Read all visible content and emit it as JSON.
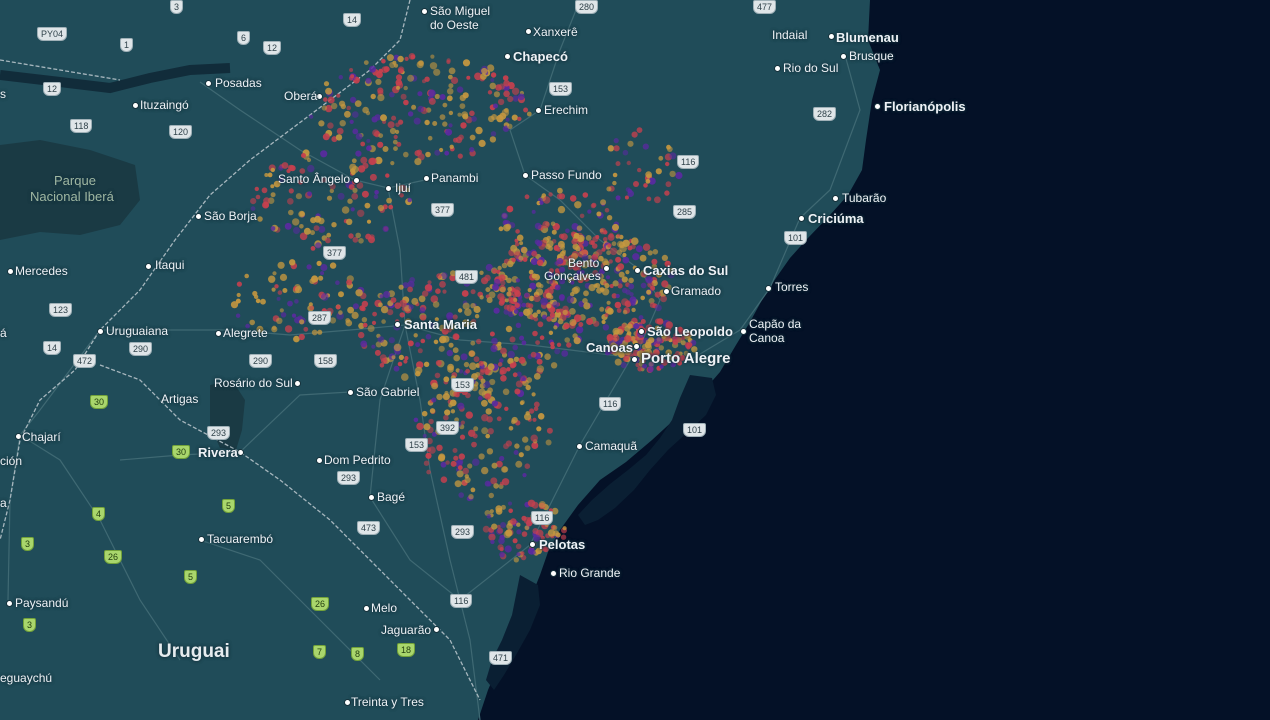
{
  "map": {
    "colors": {
      "ocean": "#041127",
      "land": "#204c59",
      "land_dark": "#193e49",
      "park": "#1a3a44",
      "border": "#a7b7be",
      "road": "#3f6973",
      "heat_low": "#c6983f",
      "heat_mid": "#c8404e",
      "heat_high": "#5a2aa0"
    },
    "labels": [
      {
        "id": "sao-miguel",
        "text": "São Miguel",
        "cls": ""
      },
      {
        "id": "do-oeste",
        "text": "do Oeste",
        "cls": ""
      },
      {
        "id": "xanxere",
        "text": "Xanxerê",
        "cls": ""
      },
      {
        "id": "chapeco",
        "text": "Chapecó",
        "cls": "major"
      },
      {
        "id": "indaial",
        "text": "Indaial",
        "cls": ""
      },
      {
        "id": "blumenau",
        "text": "Blumenau",
        "cls": "major"
      },
      {
        "id": "brusque",
        "text": "Brusque",
        "cls": ""
      },
      {
        "id": "rio-do-sul",
        "text": "Rio do Sul",
        "cls": ""
      },
      {
        "id": "florianopolis",
        "text": "Florianópolis",
        "cls": "major"
      },
      {
        "id": "tubarao",
        "text": "Tubarão",
        "cls": ""
      },
      {
        "id": "criciuma",
        "text": "Criciúma",
        "cls": "major"
      },
      {
        "id": "torres",
        "text": "Torres",
        "cls": ""
      },
      {
        "id": "capao-1",
        "text": "Capão da",
        "cls": ""
      },
      {
        "id": "capao-2",
        "text": "Canoa",
        "cls": ""
      },
      {
        "id": "posadas",
        "text": "Posadas",
        "cls": ""
      },
      {
        "id": "ituzaingo",
        "text": "Ituzaingó",
        "cls": ""
      },
      {
        "id": "obera",
        "text": "Oberá",
        "cls": ""
      },
      {
        "id": "erechim",
        "text": "Erechim",
        "cls": ""
      },
      {
        "id": "passo-fundo",
        "text": "Passo Fundo",
        "cls": ""
      },
      {
        "id": "santo-angelo",
        "text": "Santo Ângelo",
        "cls": ""
      },
      {
        "id": "ijui",
        "text": "Ijuí",
        "cls": ""
      },
      {
        "id": "panambi",
        "text": "Panambi",
        "cls": ""
      },
      {
        "id": "sao-borja",
        "text": "São Borja",
        "cls": ""
      },
      {
        "id": "bento-1",
        "text": "Bento",
        "cls": ""
      },
      {
        "id": "bento-2",
        "text": "Gonçalves",
        "cls": ""
      },
      {
        "id": "caxias",
        "text": "Caxias do Sul",
        "cls": "major"
      },
      {
        "id": "gramado",
        "text": "Gramado",
        "cls": ""
      },
      {
        "id": "mercedes",
        "text": "Mercedes",
        "cls": ""
      },
      {
        "id": "itaqui",
        "text": "Itaqui",
        "cls": ""
      },
      {
        "id": "santa-maria",
        "text": "Santa Maria",
        "cls": "major"
      },
      {
        "id": "sao-leopoldo",
        "text": "São Leopoldo",
        "cls": "major"
      },
      {
        "id": "canoas",
        "text": "Canoas",
        "cls": "major"
      },
      {
        "id": "porto-alegre",
        "text": "Porto Alegre",
        "cls": "major big"
      },
      {
        "id": "uruguaiana",
        "text": "Uruguaiana",
        "cls": ""
      },
      {
        "id": "alegrete",
        "text": "Alegrete",
        "cls": ""
      },
      {
        "id": "rosario",
        "text": "Rosário do Sul",
        "cls": ""
      },
      {
        "id": "sao-gabriel",
        "text": "São Gabriel",
        "cls": ""
      },
      {
        "id": "artigas",
        "text": "Artigas",
        "cls": ""
      },
      {
        "id": "chajari",
        "text": "Chajarí",
        "cls": ""
      },
      {
        "id": "rivera",
        "text": "Rivera",
        "cls": "major"
      },
      {
        "id": "dom-pedrito",
        "text": "Dom Pedrito",
        "cls": ""
      },
      {
        "id": "camaqua",
        "text": "Camaquã",
        "cls": ""
      },
      {
        "id": "bage",
        "text": "Bagé",
        "cls": ""
      },
      {
        "id": "tacuarembo",
        "text": "Tacuarembó",
        "cls": ""
      },
      {
        "id": "pelotas",
        "text": "Pelotas",
        "cls": "major"
      },
      {
        "id": "rio-grande",
        "text": "Rio Grande",
        "cls": ""
      },
      {
        "id": "paysandu",
        "text": "Paysandú",
        "cls": ""
      },
      {
        "id": "melo",
        "text": "Melo",
        "cls": ""
      },
      {
        "id": "jaguarao",
        "text": "Jaguarão",
        "cls": ""
      },
      {
        "id": "treinta",
        "text": "Treinta y Tres",
        "cls": ""
      },
      {
        "id": "uruguai",
        "text": "Uruguai",
        "cls": "country"
      },
      {
        "id": "eguaychu",
        "text": "eguaychú",
        "cls": ""
      },
      {
        "id": "frag-s",
        "text": "s",
        "cls": ""
      },
      {
        "id": "frag-a",
        "text": "á",
        "cls": ""
      },
      {
        "id": "frag-cion",
        "text": "ción",
        "cls": ""
      },
      {
        "id": "frag-dot",
        "text": "a",
        "cls": ""
      },
      {
        "id": "park-1",
        "text": "Parque",
        "cls": "park"
      },
      {
        "id": "park-2",
        "text": "Nacional Iberá",
        "cls": "park"
      }
    ],
    "shields": [
      {
        "id": "py04",
        "text": "PY04",
        "cls": ""
      },
      {
        "id": "r280a",
        "text": "280",
        "cls": ""
      },
      {
        "id": "r477",
        "text": "477",
        "cls": ""
      },
      {
        "id": "r14",
        "text": "14",
        "cls": ""
      },
      {
        "id": "r6",
        "text": "6",
        "cls": ""
      },
      {
        "id": "r1",
        "text": "1",
        "cls": ""
      },
      {
        "id": "r12",
        "text": "12",
        "cls": ""
      },
      {
        "id": "r3",
        "text": "3",
        "cls": ""
      },
      {
        "id": "r12b",
        "text": "12",
        "cls": ""
      },
      {
        "id": "r118",
        "text": "118",
        "cls": ""
      },
      {
        "id": "r120",
        "text": "120",
        "cls": ""
      },
      {
        "id": "r153a",
        "text": "153",
        "cls": ""
      },
      {
        "id": "r282",
        "text": "282",
        "cls": ""
      },
      {
        "id": "r116a",
        "text": "116",
        "cls": ""
      },
      {
        "id": "r285",
        "text": "285",
        "cls": ""
      },
      {
        "id": "r377a",
        "text": "377",
        "cls": ""
      },
      {
        "id": "r377b",
        "text": "377",
        "cls": ""
      },
      {
        "id": "r101a",
        "text": "101",
        "cls": ""
      },
      {
        "id": "r481",
        "text": "481",
        "cls": ""
      },
      {
        "id": "r123",
        "text": "123",
        "cls": ""
      },
      {
        "id": "r287",
        "text": "287",
        "cls": ""
      },
      {
        "id": "r14b",
        "text": "14",
        "cls": ""
      },
      {
        "id": "r290a",
        "text": "290",
        "cls": ""
      },
      {
        "id": "r290b",
        "text": "290",
        "cls": ""
      },
      {
        "id": "r158",
        "text": "158",
        "cls": ""
      },
      {
        "id": "r472",
        "text": "472",
        "cls": ""
      },
      {
        "id": "r153b",
        "text": "153",
        "cls": ""
      },
      {
        "id": "r116b",
        "text": "116",
        "cls": ""
      },
      {
        "id": "r392",
        "text": "392",
        "cls": ""
      },
      {
        "id": "r101b",
        "text": "101",
        "cls": ""
      },
      {
        "id": "r30a",
        "text": "30",
        "cls": "green"
      },
      {
        "id": "r293a",
        "text": "293",
        "cls": ""
      },
      {
        "id": "r153c",
        "text": "153",
        "cls": ""
      },
      {
        "id": "r30b",
        "text": "30",
        "cls": "green"
      },
      {
        "id": "r293b",
        "text": "293",
        "cls": ""
      },
      {
        "id": "r5a",
        "text": "5",
        "cls": "green"
      },
      {
        "id": "r4",
        "text": "4",
        "cls": "green"
      },
      {
        "id": "r473",
        "text": "473",
        "cls": ""
      },
      {
        "id": "r116c",
        "text": "116",
        "cls": ""
      },
      {
        "id": "r293c",
        "text": "293",
        "cls": ""
      },
      {
        "id": "r3g",
        "text": "3",
        "cls": "green"
      },
      {
        "id": "r26a",
        "text": "26",
        "cls": "green"
      },
      {
        "id": "r5b",
        "text": "5",
        "cls": "green"
      },
      {
        "id": "r26b",
        "text": "26",
        "cls": "green"
      },
      {
        "id": "r116d",
        "text": "116",
        "cls": ""
      },
      {
        "id": "r3h",
        "text": "3",
        "cls": "green"
      },
      {
        "id": "r7",
        "text": "7",
        "cls": "green"
      },
      {
        "id": "r8",
        "text": "8",
        "cls": "green"
      },
      {
        "id": "r18",
        "text": "18",
        "cls": "green"
      },
      {
        "id": "r471",
        "text": "471",
        "cls": ""
      }
    ]
  }
}
